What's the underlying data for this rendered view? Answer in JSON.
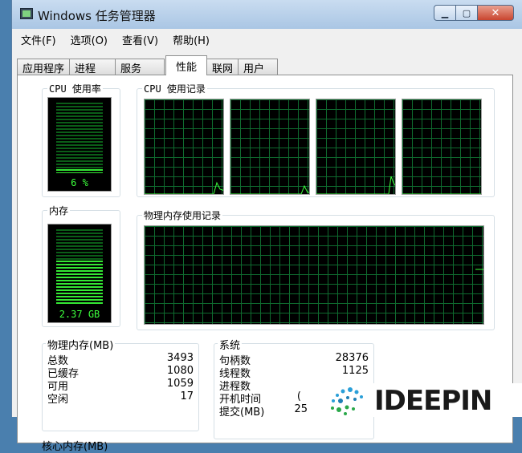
{
  "window": {
    "title": "Windows 任务管理器"
  },
  "caption_buttons": {
    "minimize": "▁",
    "maximize": "▢",
    "close": "✕"
  },
  "menu": [
    "文件(F)",
    "选项(O)",
    "查看(V)",
    "帮助(H)"
  ],
  "tabs": [
    "应用程序",
    "进程",
    "服务",
    "性能",
    "联网",
    "用户"
  ],
  "active_tab": "性能",
  "cpu": {
    "label": "CPU 使用率",
    "value": "6 %",
    "level": 0.06
  },
  "cpu_history": {
    "label": "CPU 使用记录"
  },
  "memory": {
    "label": "内存",
    "value": "2.37 GB",
    "level": 0.58
  },
  "memory_history": {
    "label": "物理内存使用记录"
  },
  "physical_memory": {
    "title": "物理内存(MB)",
    "rows": [
      {
        "label": "总数",
        "value": "3493"
      },
      {
        "label": "已缓存",
        "value": "1080"
      },
      {
        "label": "可用",
        "value": "1059"
      },
      {
        "label": "空闲",
        "value": "17"
      }
    ]
  },
  "system": {
    "title": "系统",
    "rows": [
      {
        "label": "句柄数",
        "value": "28376"
      },
      {
        "label": "线程数",
        "value": "1125"
      },
      {
        "label": "进程数",
        "value": ""
      },
      {
        "label": "开机时间",
        "value": "("
      },
      {
        "label": "提交(MB)",
        "value": "25"
      }
    ]
  },
  "kernel_memory": {
    "title": "核心内存(MB)"
  },
  "watermark": {
    "text": "IDEEPIN"
  },
  "colors": {
    "graph_grid": "#0f6b2f",
    "graph_line": "#3cff3c",
    "meter_text": "#3cff3c"
  }
}
